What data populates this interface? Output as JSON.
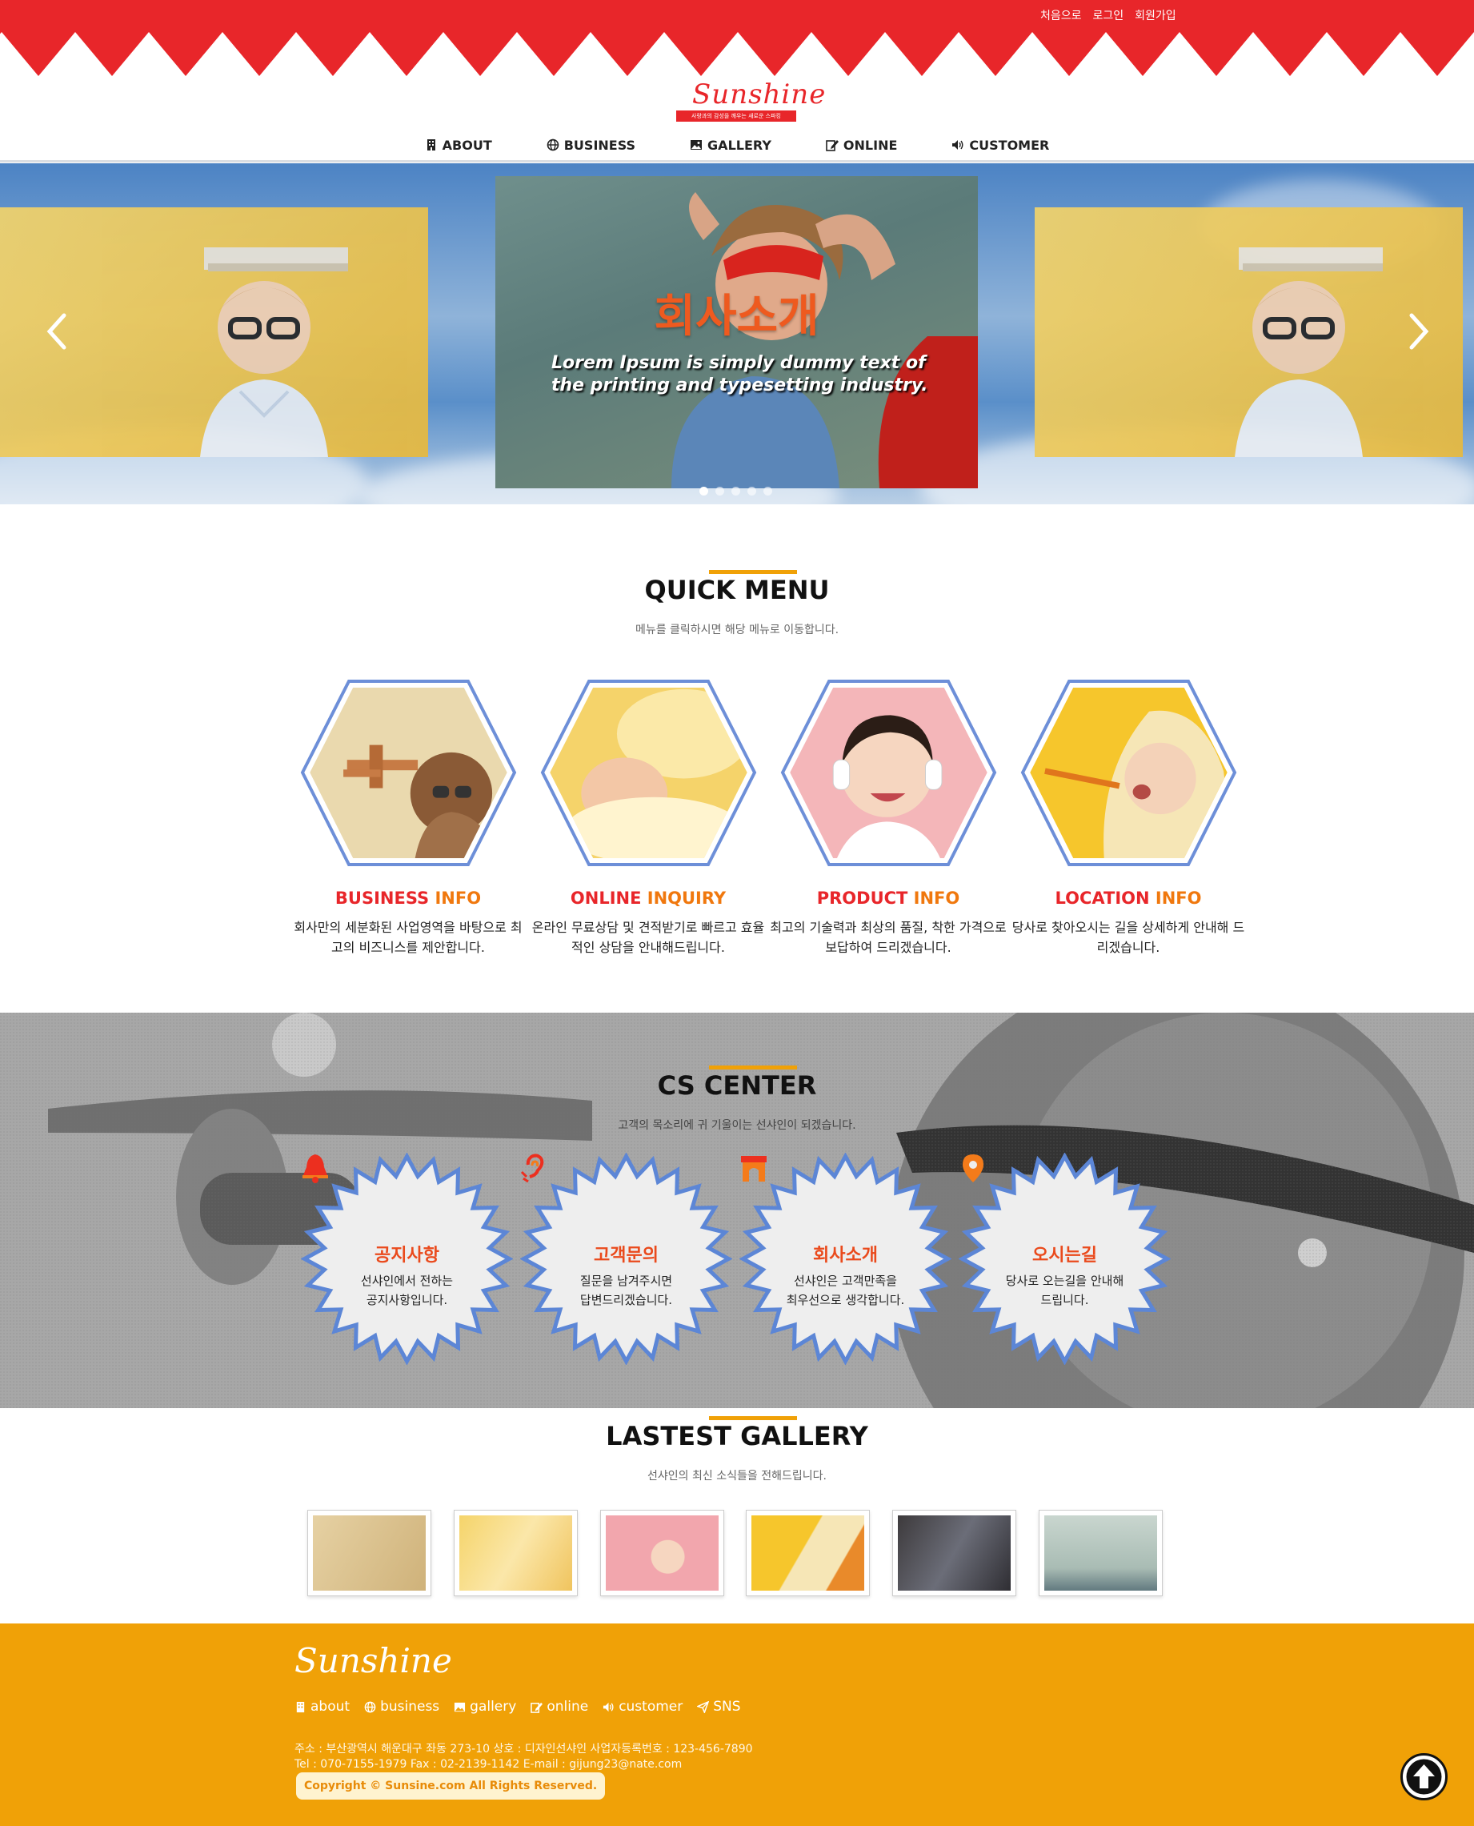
{
  "header": {
    "top_links": [
      "처음으로",
      "로그인",
      "회원가입"
    ],
    "logo_text": "Sunshine",
    "logo_tagline": "사랑과의 감성을 깨우는 새로운 스파킹",
    "nav": [
      {
        "label": "ABOUT",
        "icon": "building-icon"
      },
      {
        "label": "BUSINESS",
        "icon": "globe-icon"
      },
      {
        "label": "GALLERY",
        "icon": "image-icon"
      },
      {
        "label": "ONLINE",
        "icon": "edit-icon"
      },
      {
        "label": "CUSTOMER",
        "icon": "speaker-icon"
      }
    ]
  },
  "slider": {
    "title": "회사소개",
    "text": "Lorem Ipsum is simply dummy text of the printing and typesetting industry.",
    "dot_count": 5,
    "active_dot": 1
  },
  "quick_menu": {
    "title": "QUICK MENU",
    "subtitle": "메뉴를 클릭하시면 해당 메뉴로 이동합니다.",
    "items": [
      {
        "head_red": "BUSINESS",
        "head_orange": "INFO",
        "desc": "회사만의 세분화된 사업영역을 바탕으로 최고의 비즈니스를 제안합니다."
      },
      {
        "head_red": "ONLINE",
        "head_orange": "INQUIRY",
        "desc": "온라인 무료상담 및 견적받기로 빠르고 효율적인 상담을 안내해드립니다."
      },
      {
        "head_red": "PRODUCT",
        "head_orange": "INFO",
        "desc": "최고의 기술력과 최상의 품질, 착한 가격으로 보답하여 드리겠습니다."
      },
      {
        "head_red": "LOCATION",
        "head_orange": "INFO",
        "desc": "당사로 찾아오시는 길을 상세하게 안내해 드리겠습니다."
      }
    ]
  },
  "cs_center": {
    "title": "CS CENTER",
    "subtitle": "고객의 목소리에 귀 기울이는 선샤인이 되겠습니다.",
    "items": [
      {
        "head": "공지사항",
        "line1": "선샤인에서 전하는",
        "line2": "공지사항입니다.",
        "icon": "bell-icon"
      },
      {
        "head": "고객문의",
        "line1": "질문을 남겨주시면",
        "line2": "답변드리겠습니다.",
        "icon": "ear-icon"
      },
      {
        "head": "회사소개",
        "line1": "선샤인은 고객만족을",
        "line2": "최우선으로 생각합니다.",
        "icon": "archway-icon"
      },
      {
        "head": "오시는길",
        "line1": "당사로 오는길을 안내해",
        "line2": "드립니다.",
        "icon": "map-pin-icon"
      }
    ]
  },
  "gallery": {
    "title": "LASTEST GALLERY",
    "subtitle": "선샤인의 최신 소식들을 전해드립니다.",
    "thumb_count": 6
  },
  "footer": {
    "logo_text": "Sunshine",
    "links": [
      {
        "label": "about",
        "icon": "building-icon"
      },
      {
        "label": "business",
        "icon": "globe-icon"
      },
      {
        "label": "gallery",
        "icon": "image-icon"
      },
      {
        "label": "online",
        "icon": "edit-icon"
      },
      {
        "label": "customer",
        "icon": "speaker-icon"
      },
      {
        "label": "SNS",
        "icon": "send-icon"
      }
    ],
    "info_line1": "주소 : 부산광역시 해운대구 좌동 273-10   상호 : 디자인선샤인   사업자등록번호 : 123-456-7890",
    "info_line2": "Tel : 070-7155-1979   Fax : 02-2139-1142   E-mail : gijung23@nate.com",
    "copyright": "Copyright © Sunsine.com All Rights Reserved."
  },
  "colors": {
    "brand_red": "#e8262a",
    "accent_orange": "#f0a107",
    "hex_border": "#6d8fd8"
  }
}
